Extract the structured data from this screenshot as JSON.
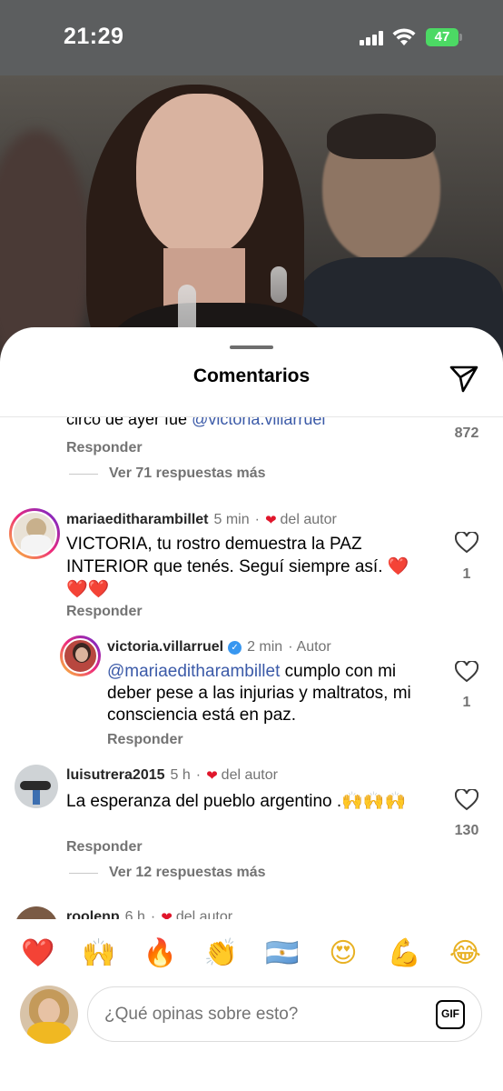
{
  "status_bar": {
    "time": "21:29",
    "battery": "47"
  },
  "sheet": {
    "title": "Comentarios"
  },
  "thread_top": {
    "cut_text": "circo de ayer fue ",
    "cut_mention": "@victoria.villarruel",
    "likes": "872",
    "reply_label": "Responder",
    "more_replies": "Ver 71 respuestas más"
  },
  "comments": [
    {
      "username": "mariaeditharambillet",
      "time": "5 min",
      "badge": "del autor",
      "text": "VICTORIA, tu rostro demuestra la PAZ INTERIOR  que tenés. Seguí siempre así. ",
      "emoji": "❤️❤️❤️",
      "likes": "1",
      "reply_label": "Responder"
    },
    {
      "username": "victoria.villarruel",
      "time": "2 min",
      "badge": "Autor",
      "mention": "@mariaeditharambillet",
      "text": " cumplo con mi deber pese a las injurias y maltratos, mi consciencia está en paz.",
      "likes": "1",
      "reply_label": "Responder"
    },
    {
      "username": "luisutrera2015",
      "time": "5 h",
      "badge": "del autor",
      "text": "La esperanza del pueblo argentino .",
      "emoji": "🙌🙌🙌",
      "likes": "130",
      "reply_label": "Responder",
      "more_replies": "Ver 12 respuestas más"
    },
    {
      "username": "roolenp",
      "time": "6 h",
      "badge": "del autor"
    }
  ],
  "reactions": [
    "❤️",
    "🙌",
    "🔥",
    "👏",
    "🇦🇷",
    "😍",
    "💪",
    "😂"
  ],
  "composer": {
    "placeholder": "¿Qué opinas sobre esto?",
    "gif_label": "GIF"
  },
  "colors": {
    "mention": "#3b5aa8",
    "heart": "#e0162b",
    "muted": "#737373"
  },
  "icons": [
    "share-icon",
    "heart-outline-icon",
    "verified-icon",
    "gif-icon"
  ]
}
